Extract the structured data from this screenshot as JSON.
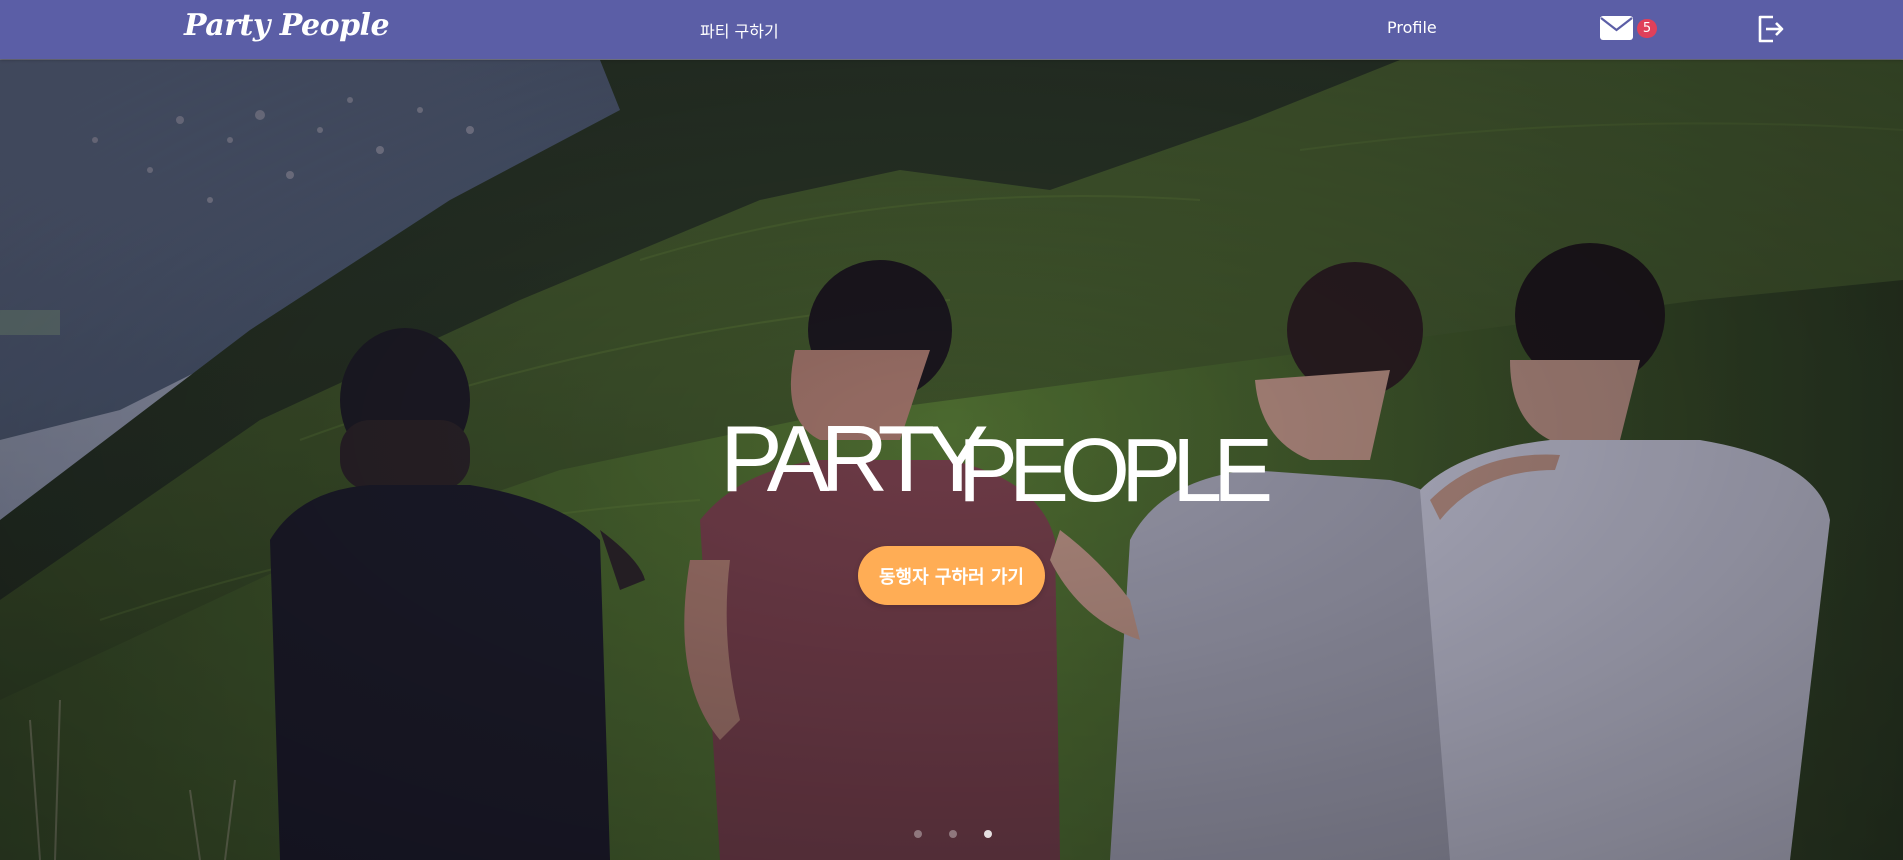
{
  "navbar": {
    "brand": "Party People",
    "find_party_link": "파티 구하기",
    "profile_link": "Profile",
    "mail": {
      "icon": "envelope-icon",
      "unread_count": "5"
    },
    "logout": {
      "icon": "logout-icon"
    }
  },
  "hero": {
    "title_part1": "PARTY",
    "title_part2": "PEOPLE",
    "cta_label": "동행자 구하러 가기",
    "background": "four friends sitting on a green mountain ridge",
    "carousel": {
      "slides": 3,
      "active_index": 2
    }
  },
  "colors": {
    "navbar": "#5b5ea6",
    "cta": "#ffad55",
    "badge": "#e0405a",
    "text": "#ffffff"
  }
}
